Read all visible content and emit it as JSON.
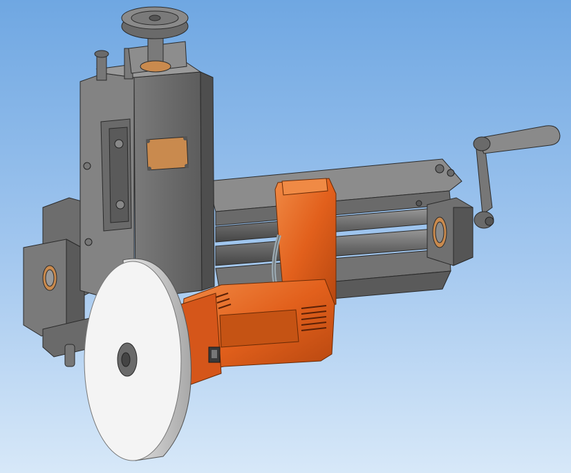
{
  "viewport": {
    "background_top": "#6fa7e2",
    "background_bottom": "#d7e8f8"
  },
  "colors": {
    "steel_light": "#8d8d8d",
    "steel_mid": "#6e6e6e",
    "steel_dark": "#4e4e4e",
    "steel_edge": "#2a2a2a",
    "housing_orange": "#e2601c",
    "housing_orange_dark": "#b5460f",
    "housing_orange_light": "#f08a45",
    "disc_face": "#f4f4f4",
    "disc_rim": "#bdbdbd",
    "bushing_bronze": "#c98a4e"
  },
  "parts": [
    {
      "name": "pressure-screw-handwheel-icon"
    },
    {
      "name": "vertical-column-housing-icon"
    },
    {
      "name": "roller-shafts-assembly-icon"
    },
    {
      "name": "crank-handle-icon"
    },
    {
      "name": "electric-drill-drive-icon"
    },
    {
      "name": "grinding-disc-icon"
    },
    {
      "name": "front-bearing-block-icon"
    }
  ]
}
